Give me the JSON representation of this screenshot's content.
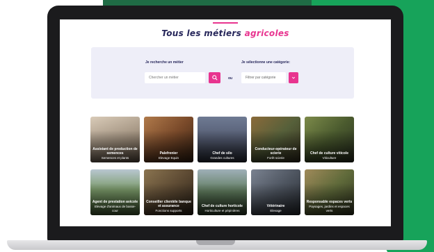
{
  "page": {
    "title_main": "Tous les métiers",
    "title_accent": "agricoles"
  },
  "search": {
    "job_label": "Je recherche un métier",
    "job_placeholder": "Chercher un métier",
    "or_label": "ou",
    "category_label": "Je sélectionne une catégorie:",
    "category_placeholder": "Filtrer par catégorie"
  },
  "cards": [
    {
      "name": "Assistant de production de semences",
      "category": "Semences et plants"
    },
    {
      "name": "Palefrenier",
      "category": "Elevage Equin"
    },
    {
      "name": "Chef de silo",
      "category": "Grandes cultures"
    },
    {
      "name": "Conducteur-opérateur de scierie",
      "category": "Forêt scierie"
    },
    {
      "name": "Chef de culture viticole",
      "category": "Viticulture"
    },
    {
      "name": "Agent de prestation avicole",
      "category": "Elevage d'animaux de basse-cour"
    },
    {
      "name": "Conseiller clientèle banque et assurance",
      "category": "Fonctions supports"
    },
    {
      "name": "Chef de culture horticole",
      "category": "Horticulture et pépinières"
    },
    {
      "name": "Vétérinaire",
      "category": "Elevage"
    },
    {
      "name": "Responsable espaces verts",
      "category": "Paysages, jardins et espaces verts"
    }
  ],
  "colors": {
    "accent_pink": "#e8348f",
    "navy": "#26265a",
    "brand_green": "#17a35a"
  }
}
